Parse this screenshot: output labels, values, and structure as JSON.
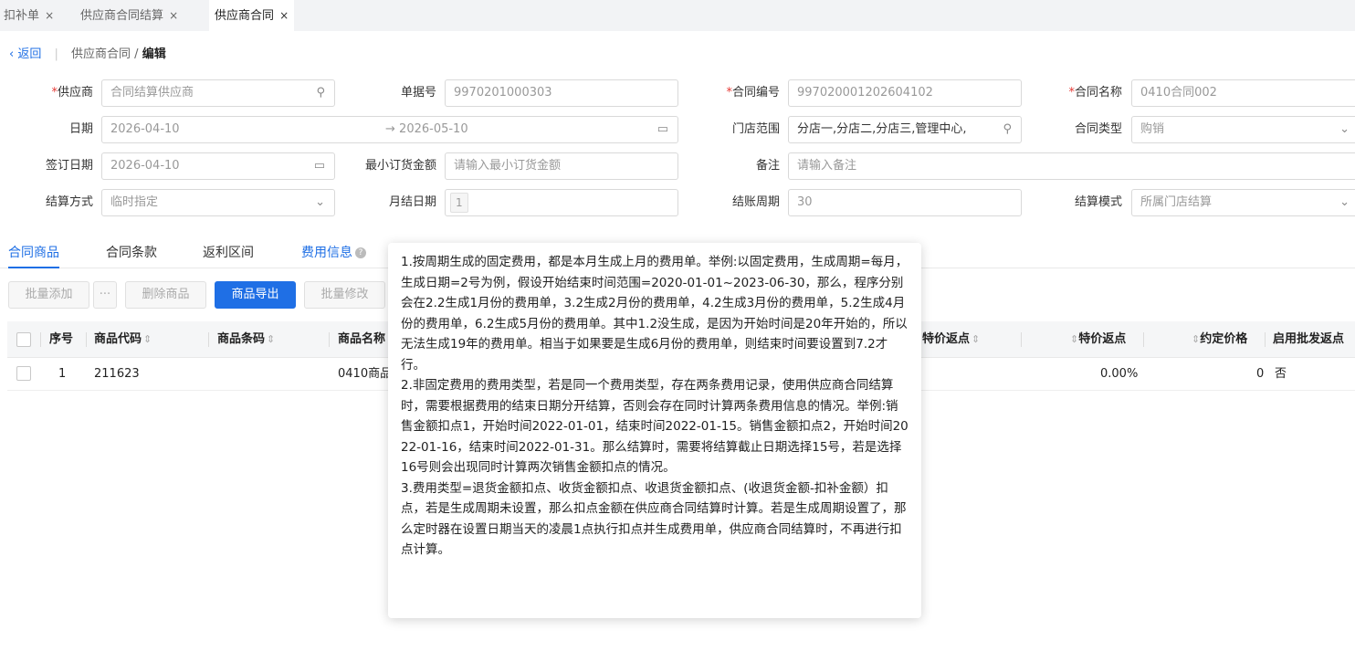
{
  "tabs": [
    {
      "label": "扣补单",
      "close": "×"
    },
    {
      "label": "供应商合同结算",
      "close": "×"
    },
    {
      "label": "供应商合同",
      "close": "×"
    }
  ],
  "breadcrumb": {
    "back": "返回",
    "path": "供应商合同 / ",
    "current": "编辑"
  },
  "form": {
    "supplier": {
      "label": "供应商",
      "value": "合同结算供应商"
    },
    "doc_no": {
      "label": "单据号",
      "value": "9970201000303"
    },
    "contract_no": {
      "label": "合同编号",
      "value": "997020001202604102"
    },
    "contract_name": {
      "label": "合同名称",
      "value": "0410合同002"
    },
    "date": {
      "label": "日期",
      "start": "2026-04-10",
      "arrow": "→",
      "end": "2026-05-10"
    },
    "store_scope": {
      "label": "门店范围",
      "value": "分店一,分店二,分店三,管理中心,"
    },
    "contract_type": {
      "label": "合同类型",
      "value": "购销"
    },
    "sign_date": {
      "label": "签订日期",
      "value": "2026-04-10"
    },
    "min_order": {
      "label": "最小订货金额",
      "placeholder": "请输入最小订货金额"
    },
    "remark": {
      "label": "备注",
      "placeholder": "请输入备注"
    },
    "settle_method": {
      "label": "结算方式",
      "value": "临时指定"
    },
    "month_day": {
      "label": "月结日期",
      "value": "1"
    },
    "billing_cycle": {
      "label": "结账周期",
      "value": "30"
    },
    "settle_mode": {
      "label": "结算模式",
      "value": "所属门店结算"
    }
  },
  "subtabs": [
    "合同商品",
    "合同条款",
    "返利区间",
    "费用信息"
  ],
  "buttons": {
    "batch_add": "批量添加",
    "more": "···",
    "delete": "删除商品",
    "export": "商品导出",
    "batch_edit": "批量修改"
  },
  "table": {
    "headers": [
      "序号",
      "商品代码",
      "商品条码",
      "商品名称",
      "特价返点",
      "特价返点",
      "约定价格",
      "启用批发返点"
    ],
    "rows": [
      {
        "index": "1",
        "code": "211623",
        "barcode": "",
        "name": "0410商品",
        "rebate": "0.00%",
        "price": "0",
        "wholesale": "否"
      }
    ]
  },
  "tooltip": [
    "1.按周期生成的固定费用，都是本月生成上月的费用单。举例:以固定费用，生成周期=每月，生成日期=2号为例，假设开始结束时间范围=2020-01-01~2023-06-30，那么，程序分别会在2.2生成1月份的费用单，3.2生成2月份的费用单，4.2生成3月份的费用单，5.2生成4月份的费用单，6.2生成5月份的费用单。其中1.2没生成，是因为开始时间是20年开始的，所以无法生成19年的费用单。相当于如果要是生成6月份的费用单，则结束时间要设置到7.2才行。",
    "2.非固定费用的费用类型，若是同一个费用类型，存在两条费用记录，使用供应商合同结算时，需要根据费用的结束日期分开结算，否则会存在同时计算两条费用信息的情况。举例:销售金额扣点1，开始时间2022-01-01，结束时间2022-01-15。销售金额扣点2，开始时间2022-01-16，结束时间2022-01-31。那么结算时，需要将结算截止日期选择15号，若是选择16号则会出现同时计算两次销售金额扣点的情况。",
    "3.费用类型=退货金额扣点、收货金额扣点、收退货金额扣点、(收退货金额-扣补金额）扣点，若是生成周期未设置，那么扣点金额在供应商合同结算时计算。若是生成周期设置了，那么定时器在设置日期当天的凌晨1点执行扣点并生成费用单，供应商合同结算时，不再进行扣点计算。"
  ]
}
